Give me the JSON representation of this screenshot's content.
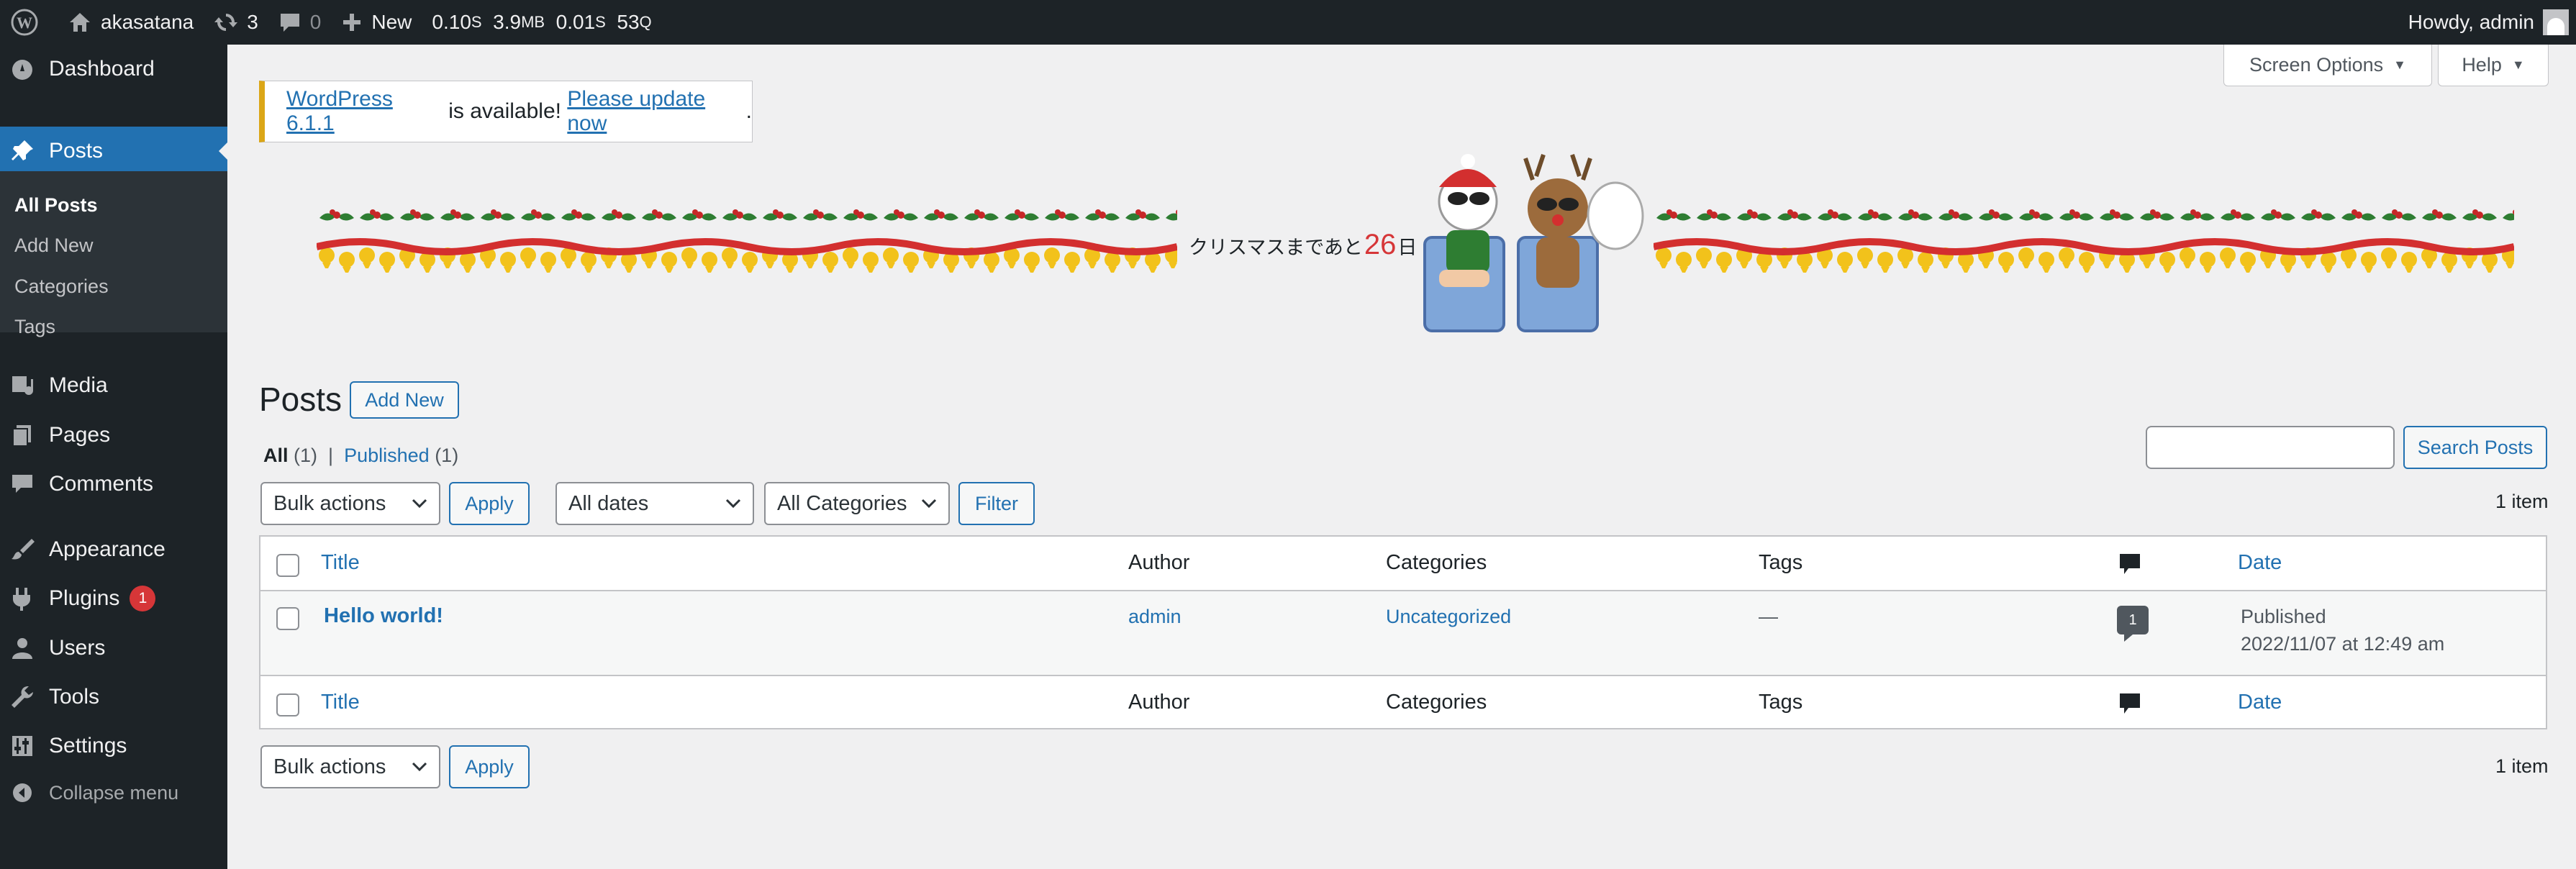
{
  "adminbar": {
    "site_name": "akasatana",
    "updates_count": "3",
    "comments_count": "0",
    "new_label": "New",
    "perf": {
      "time": "0.10",
      "time_unit": "S",
      "memory": "3.9",
      "memory_unit": "MB",
      "query_time": "0.01",
      "query_unit": "S",
      "queries": "53",
      "queries_unit": "Q"
    },
    "howdy": "Howdy, admin"
  },
  "sidebar": {
    "dashboard": "Dashboard",
    "posts": "Posts",
    "submenu": [
      "All Posts",
      "Add New",
      "Categories",
      "Tags"
    ],
    "media": "Media",
    "pages": "Pages",
    "comments": "Comments",
    "appearance": "Appearance",
    "plugins": "Plugins",
    "plugins_badge": "1",
    "users": "Users",
    "tools": "Tools",
    "settings": "Settings",
    "collapse": "Collapse menu"
  },
  "screen_options": {
    "label": "Screen Options"
  },
  "help": {
    "label": "Help"
  },
  "notice": {
    "version_link": "WordPress 6.1.1",
    "middle": " is available! ",
    "update_link": "Please update now",
    "end": "."
  },
  "banner": {
    "prefix": "クリスマスまであと",
    "days": "26",
    "suffix": "日"
  },
  "page": {
    "title": "Posts",
    "add_new": "Add New"
  },
  "filters": {
    "all_label": "All",
    "all_count": "(1)",
    "separator": "|",
    "published_label": "Published",
    "published_count": "(1)",
    "bulk_actions": "Bulk actions",
    "apply": "Apply",
    "dates": "All dates",
    "categories": "All Categories",
    "filter": "Filter",
    "search_button": "Search Posts",
    "search_placeholder": "",
    "items_count": "1 item"
  },
  "table": {
    "columns": {
      "title": "Title",
      "author": "Author",
      "categories": "Categories",
      "tags": "Tags",
      "date": "Date"
    },
    "rows": [
      {
        "title": "Hello world!",
        "author": "admin",
        "category": "Uncategorized",
        "tags": "—",
        "comments": "1",
        "status": "Published",
        "date": "2022/11/07 at 12:49 am"
      }
    ]
  },
  "colors": {
    "admin_dark": "#1d2327",
    "accent": "#2271b1",
    "notice_warning": "#dba617",
    "badge": "#d63638",
    "page_bg": "#f0f0f1"
  }
}
